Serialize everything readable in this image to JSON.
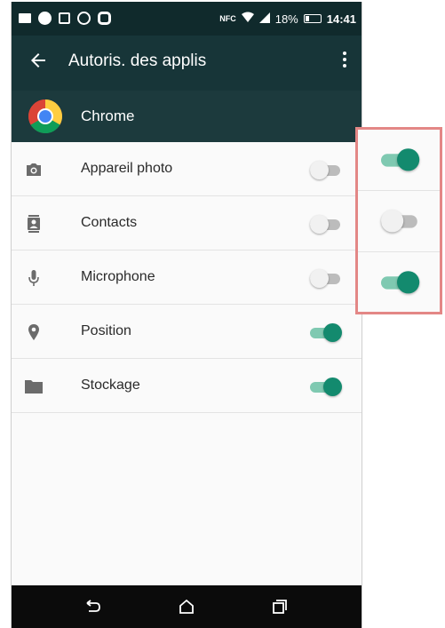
{
  "status_bar": {
    "nfc": "NFC",
    "battery": "18%",
    "time": "14:41"
  },
  "app_bar": {
    "title": "Autoris. des applis"
  },
  "app_header": {
    "app_name": "Chrome"
  },
  "permissions": [
    {
      "label": "Appareil photo",
      "icon": "camera-icon",
      "enabled": false
    },
    {
      "label": "Contacts",
      "icon": "contacts-icon",
      "enabled": false
    },
    {
      "label": "Microphone",
      "icon": "microphone-icon",
      "enabled": false
    },
    {
      "label": "Position",
      "icon": "location-pin-icon",
      "enabled": true
    },
    {
      "label": "Stockage",
      "icon": "folder-icon",
      "enabled": true
    }
  ],
  "callout_toggles": [
    {
      "enabled": true
    },
    {
      "enabled": false
    },
    {
      "enabled": true
    }
  ],
  "colors": {
    "toolbar": "#173538",
    "status_bar": "#102a2c",
    "accent": "#138a6e",
    "callout_border": "#e38786"
  }
}
